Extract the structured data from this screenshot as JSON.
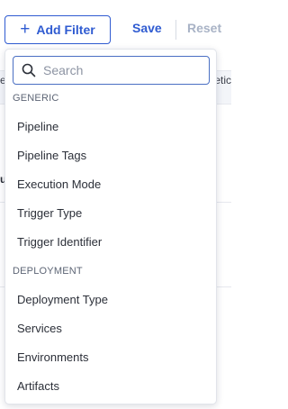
{
  "toolbar": {
    "add_filter_label": "Add Filter",
    "add_filter_icon": "plus-icon",
    "save_label": "Save",
    "reset_label": "Reset"
  },
  "background": {
    "header_left_fragment": "e",
    "header_right_fragment": "etic",
    "row_left_fragment": "u"
  },
  "dropdown": {
    "search": {
      "placeholder": "Search",
      "value": "",
      "icon": "search-icon"
    },
    "groups": [
      {
        "label": "GENERIC",
        "items": [
          "Pipeline",
          "Pipeline Tags",
          "Execution Mode",
          "Trigger Type",
          "Trigger Identifier"
        ]
      },
      {
        "label": "DEPLOYMENT",
        "items": [
          "Deployment Type",
          "Services",
          "Environments",
          "Artifacts"
        ]
      }
    ]
  },
  "colors": {
    "accent": "#2f5bd1",
    "disabled": "#a9b3c6",
    "text": "#2b2f38",
    "section": "#5d6575"
  }
}
